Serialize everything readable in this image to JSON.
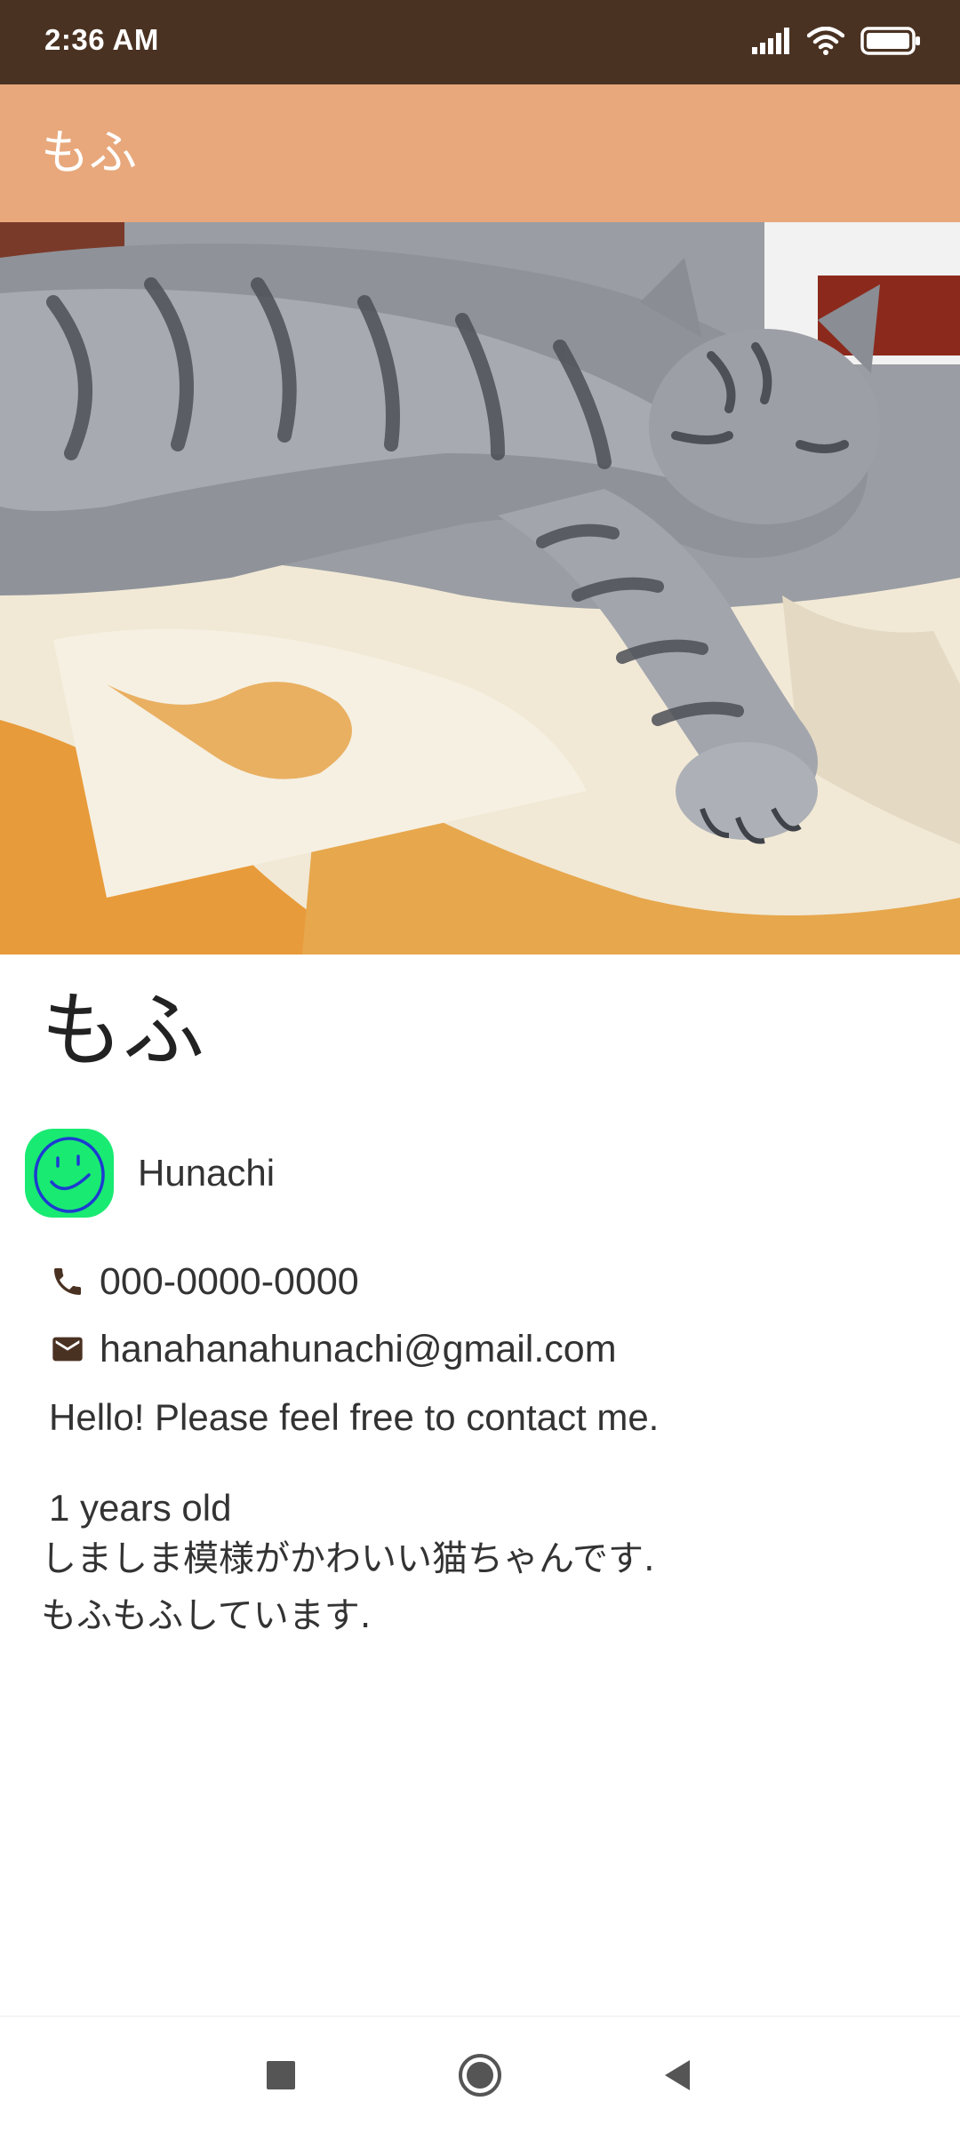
{
  "status_bar": {
    "time": "2:36 AM",
    "icons": [
      "signal-icon",
      "wifi-icon",
      "battery-icon"
    ]
  },
  "app_bar": {
    "title": "もふ"
  },
  "colors": {
    "status_bar": "#4a3222",
    "app_bar": "#e8a87c",
    "icon_brown": "#4a3222",
    "avatar_green": "#19ea72",
    "avatar_stroke": "#1d3bd1"
  },
  "profile": {
    "name": "もふ",
    "owner": {
      "name": "Hunachi",
      "avatar": "smiley-avatar"
    },
    "phone": "000-0000-0000",
    "email": "hanahanahunachi@gmail.com",
    "message": "Hello! Please feel free to contact me.",
    "age": "1 years old",
    "description": [
      "しましま模様がかわいい猫ちゃんです.",
      "もふもふしています."
    ]
  },
  "nav_bar": {
    "icons": [
      "recents-square-icon",
      "home-circle-icon",
      "back-triangle-icon"
    ]
  }
}
